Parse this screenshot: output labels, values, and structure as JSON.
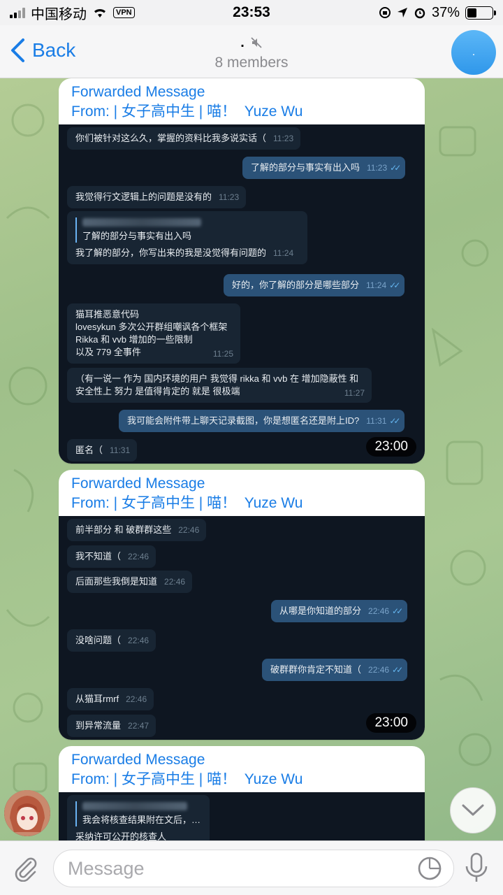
{
  "status_bar": {
    "carrier": "中国移动",
    "vpn": "VPN",
    "time": "23:53",
    "battery": "37%",
    "battery_level": 0.37
  },
  "header": {
    "back_label": "Back",
    "title": ".",
    "subtitle": "8 members",
    "avatar_text": "."
  },
  "forward": {
    "label": "Forwarded Message",
    "from_prefix": "From: | 女子高中生 | 喵！",
    "from_name": "Yuze Wu"
  },
  "shot1": {
    "time_badge": "23:00",
    "msgs": [
      {
        "text": "你们被针对这么久，掌握的资料比我多说实话（",
        "time": "11:23"
      },
      {
        "text": "了解的部分与事实有出入吗",
        "time": "11:23"
      },
      {
        "text": "我觉得行文逻辑上的问题是没有的",
        "time": "11:23"
      },
      {
        "quote": "了解的部分与事实有出入吗",
        "text": "我了解的部分，你写出来的我是没觉得有问题的",
        "time": "11:24"
      },
      {
        "text": "好的，你了解的部分是哪些部分",
        "time": "11:24"
      },
      {
        "lines": [
          "猫耳推恶意代码",
          "lovesykun 多次公开群组嘲讽各个框架",
          "Rikka 和 vvb 增加的一些限制",
          "以及 779 全事件"
        ],
        "time": "11:25"
      },
      {
        "lines": [
          "（有一说一 作为 国内环境的用户 我觉得 rikka 和 vvb 在 增加隐蔽性 和",
          "安全性上 努力 是值得肯定的 就是 很极端"
        ],
        "time": "11:27"
      },
      {
        "text": "我可能会附件带上聊天记录截图，你是想匿名还是附上ID?",
        "time": "11:31"
      },
      {
        "text": "匿名（",
        "time": "11:31"
      }
    ]
  },
  "shot2": {
    "time_badge": "23:00",
    "msgs": [
      {
        "text": "前半部分 和 破群群这些",
        "time": "22:46"
      },
      {
        "text": "我不知道（",
        "time": "22:46"
      },
      {
        "text": "后面那些我倒是知道",
        "time": "22:46"
      },
      {
        "text": "从哪是你知道的部分",
        "time": "22:46"
      },
      {
        "text": "没啥问题（",
        "time": "22:46"
      },
      {
        "text": "破群群你肯定不知道（",
        "time": "22:46"
      },
      {
        "text": "从猫耳rmrf",
        "time": "22:46"
      },
      {
        "text": "到异常流量",
        "time": "22:47"
      }
    ]
  },
  "shot3": {
    "msgs": [
      {
        "text": "我会将核查结果附在文后，…",
        "text2": "采纳许可公开的核查人"
      }
    ]
  },
  "input": {
    "placeholder": "Message"
  },
  "colors": {
    "accent": "#1a7de6",
    "dark_bg": "#0e1621",
    "in_bubble": "#182533",
    "out_bubble": "#2b5278"
  }
}
